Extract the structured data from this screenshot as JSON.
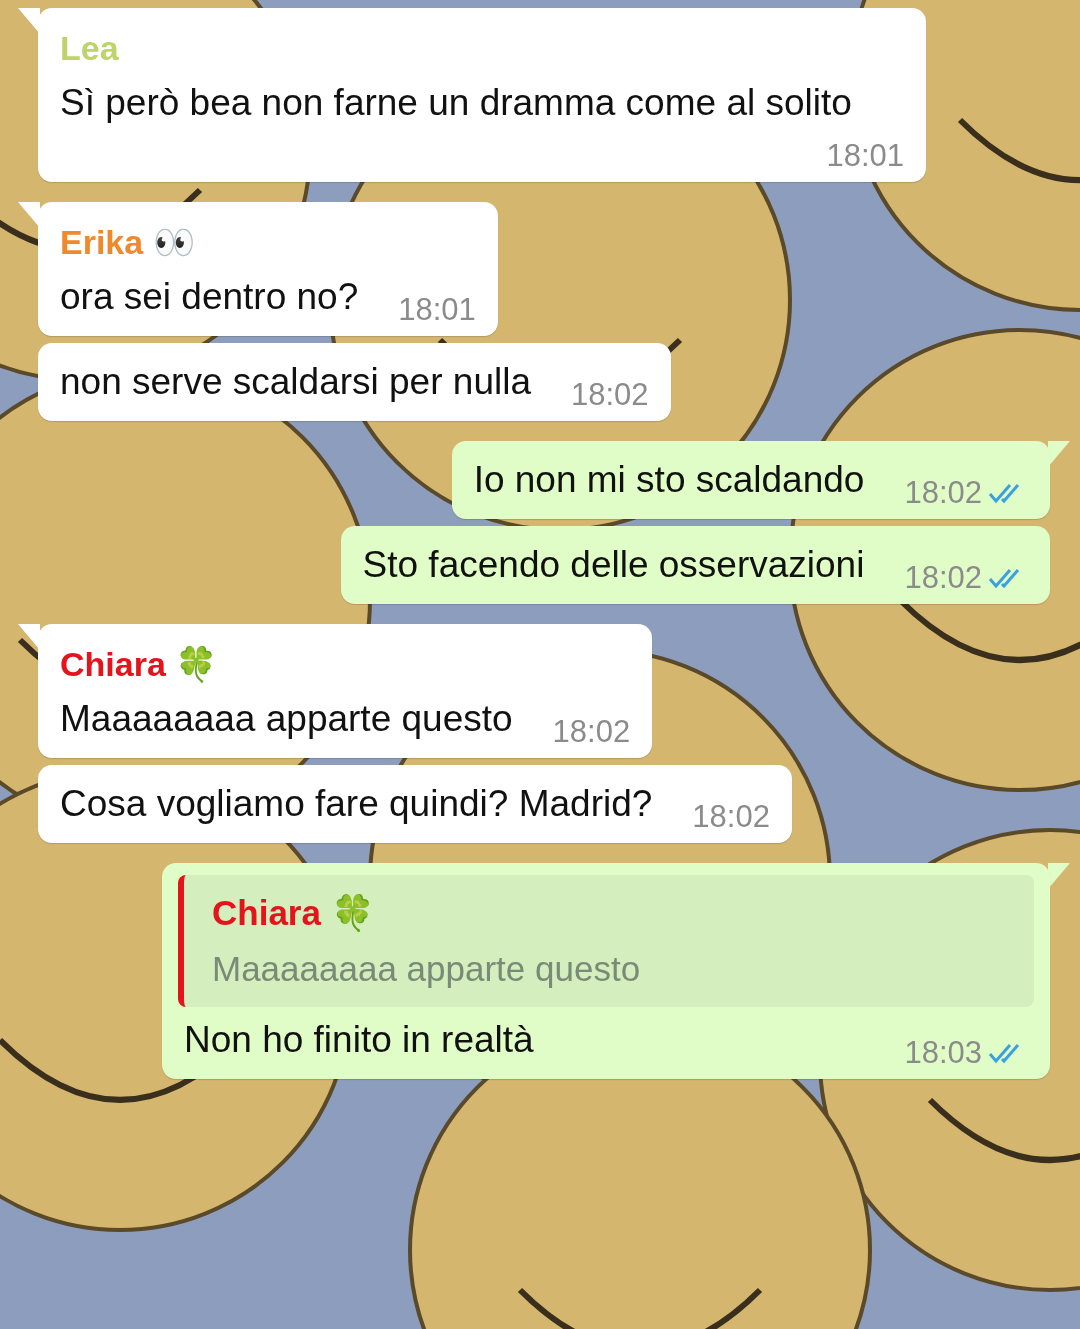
{
  "messages": [
    {
      "kind": "incoming",
      "tail": true,
      "sender": {
        "name": "Lea",
        "color": "#bcd46a"
      },
      "text": "Sì però bea non farne un dramma come al solito",
      "time": "18:01"
    },
    {
      "kind": "incoming",
      "tail": true,
      "sender": {
        "name": "Erika 👀",
        "color": "#f0892c"
      },
      "text": "ora sei dentro no?",
      "time": "18:01"
    },
    {
      "kind": "incoming",
      "tail": false,
      "text": "non serve scaldarsi per nulla",
      "time": "18:02"
    },
    {
      "kind": "outgoing",
      "tail": true,
      "text": "Io non mi sto scaldando",
      "time": "18:02",
      "read": true
    },
    {
      "kind": "outgoing",
      "tail": false,
      "text": "Sto facendo delle osservazioni",
      "time": "18:02",
      "read": true
    },
    {
      "kind": "incoming",
      "tail": true,
      "sender": {
        "name": "Chiara 🍀",
        "color": "#e3141c"
      },
      "text": "Maaaaaaaa apparte questo",
      "time": "18:02"
    },
    {
      "kind": "incoming",
      "tail": false,
      "text": "Cosa vogliamo fare quindi? Madrid?",
      "time": "18:02"
    },
    {
      "kind": "outgoing",
      "tail": true,
      "reply": {
        "name": "Chiara 🍀",
        "color": "#e3141c",
        "text": "Maaaaaaaa apparte questo"
      },
      "text": "Non ho finito in realtà",
      "time": "18:03",
      "read": true
    }
  ]
}
